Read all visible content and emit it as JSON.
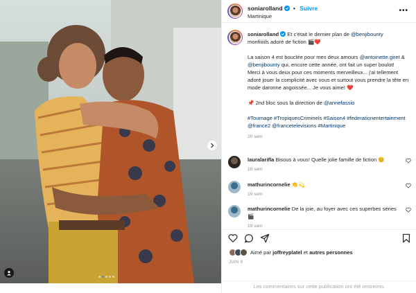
{
  "post": {
    "carousel": {
      "slide_count": 5,
      "active_index": 1
    },
    "accent_color": "#0095f6",
    "link_color": "#00376b"
  },
  "header": {
    "username": "soniarolland",
    "follow_label": "Suivre",
    "separator": "•",
    "location": "Martinique",
    "more_label": "•••"
  },
  "caption": {
    "username": "soniarolland",
    "line1_text": "Et c'était le dernier plan de",
    "mention1": "@benjibounty",
    "line2_text": "monfiiiiils adoré de fiction 🎬❤️",
    "para2_a": "La saison 4 est bouclée pour mes deux amours",
    "mention2": "@antoinette.giret",
    "para2_and": "&",
    "mention3": "@benjibounty",
    "para2_b": "qui, encore cette année, ont fait un super boulot!",
    "para3": "Merci à vous deux pour ces moments merveilleux... j'ai tellement adoré jouer la complicité avec vous et surtout vous prendre la tête en mode daronne angoissée... Je vous aime! ❤️",
    "para4_text": "📌 2nd bloc sous la direction de",
    "mention4": "@annefassio",
    "hashtags": "#Tournage #TropiquesCriminels #Saison4 #federationentertainment @france2 @francetelevisions #Martinique",
    "time": "20 sem"
  },
  "comments": [
    {
      "username": "lauralarifla",
      "text": "Bisous à vous! Quelle jolie famille de fiction 😊",
      "time": "19 sem"
    },
    {
      "username": "mathurincornelie",
      "text": "👏💫",
      "time": "19 sem"
    },
    {
      "username": "mathurincornelie",
      "text": "De la joie, au foyer avec ces superbes séries 🎬",
      "time": "19 sem"
    }
  ],
  "actions": {
    "icons": [
      "heart-icon",
      "comment-icon",
      "share-icon",
      "bookmark-icon"
    ],
    "liked_by_prefix": "Aimé par",
    "liked_by_user": "joffreyplatel",
    "liked_by_and": "et",
    "liked_by_others": "autres personnes",
    "date": "JUIN 9"
  },
  "footer": {
    "restricted_notice": "Les commentaires sur cette publication ont été restreints."
  }
}
